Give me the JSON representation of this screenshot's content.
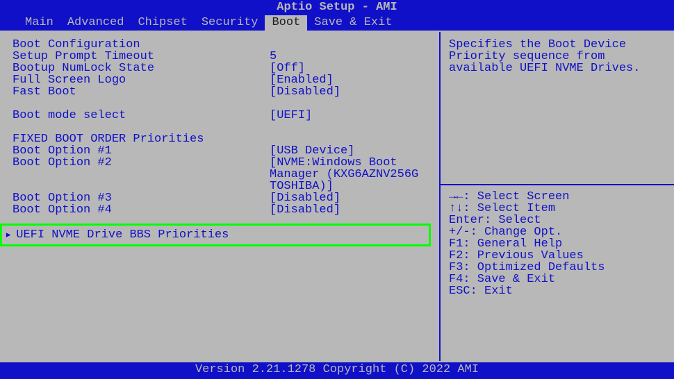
{
  "title": "Aptio Setup - AMI",
  "menu": {
    "items": [
      "Main",
      "Advanced",
      "Chipset",
      "Security",
      "Boot",
      "Save & Exit"
    ],
    "active_index": 4
  },
  "boot_config": {
    "header": "Boot Configuration",
    "settings": [
      {
        "label": "Setup Prompt Timeout",
        "value": "5"
      },
      {
        "label": "Bootup NumLock State",
        "value": "[Off]"
      },
      {
        "label": "Full Screen Logo",
        "value": "[Enabled]"
      },
      {
        "label": "Fast Boot",
        "value": "[Disabled]"
      }
    ],
    "boot_mode": {
      "label": "Boot mode select",
      "value": "[UEFI]"
    },
    "priorities_header": "FIXED BOOT ORDER Priorities",
    "boot_options": [
      {
        "label": "Boot Option #1",
        "value": "[USB Device]"
      },
      {
        "label": "Boot Option #2",
        "value": "[NVME:Windows Boot Manager (KXG6AZNV256G TOSHIBA)]"
      },
      {
        "label": "Boot Option #3",
        "value": "[Disabled]"
      },
      {
        "label": "Boot Option #4",
        "value": "[Disabled]"
      }
    ],
    "submenu_label": "UEFI NVME Drive BBS Priorities"
  },
  "help": {
    "description": "Specifies the Boot Device Priority sequence from available UEFI NVME Drives.",
    "keys": [
      "→←: Select Screen",
      "↑↓: Select Item",
      "Enter: Select",
      "+/-: Change Opt.",
      "F1: General Help",
      "F2: Previous Values",
      "F3: Optimized Defaults",
      "F4: Save & Exit",
      "ESC: Exit"
    ]
  },
  "footer": "Version 2.21.1278 Copyright (C) 2022 AMI"
}
